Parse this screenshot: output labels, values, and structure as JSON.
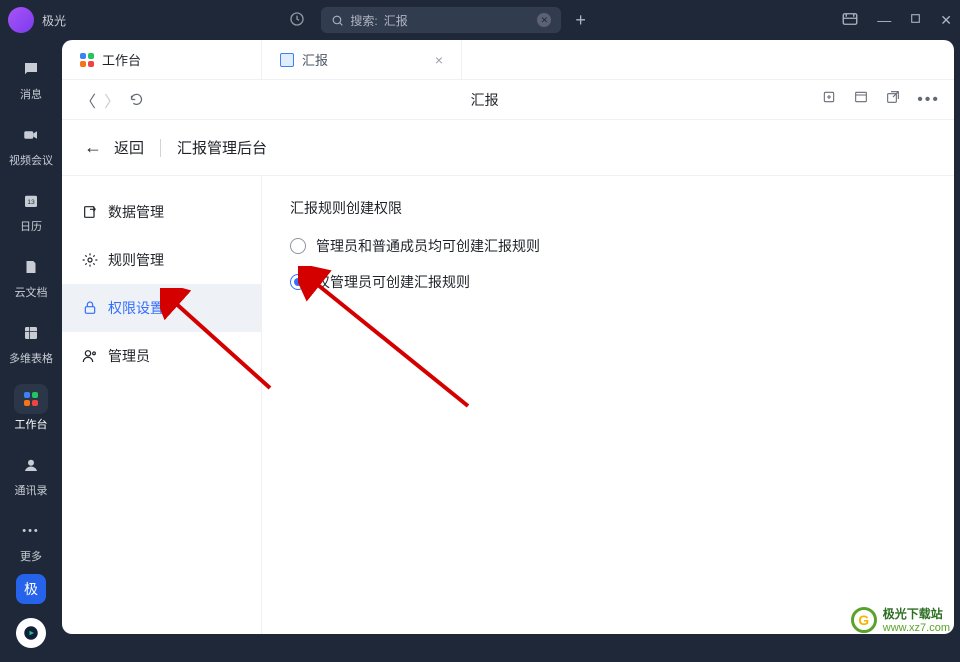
{
  "titlebar": {
    "brand": "极光",
    "search_prefix": "搜索:",
    "search_term": "汇报"
  },
  "leftrail": {
    "items": [
      {
        "label": "消息"
      },
      {
        "label": "视频会议"
      },
      {
        "label": "日历"
      },
      {
        "label": "云文档"
      },
      {
        "label": "多维表格"
      },
      {
        "label": "工作台"
      },
      {
        "label": "通讯录"
      },
      {
        "label": "更多"
      }
    ],
    "bottom_badge": "极"
  },
  "tabs": {
    "workbench": "工作台",
    "report": "汇报"
  },
  "toolbar": {
    "title": "汇报"
  },
  "page_header": {
    "back": "返回",
    "title": "汇报管理后台"
  },
  "side_menu": {
    "items": [
      {
        "label": "数据管理"
      },
      {
        "label": "规则管理"
      },
      {
        "label": "权限设置"
      },
      {
        "label": "管理员"
      }
    ]
  },
  "panel": {
    "title": "汇报规则创建权限",
    "options": [
      {
        "label": "管理员和普通成员均可创建汇报规则",
        "checked": false
      },
      {
        "label": "仅管理员可创建汇报规则",
        "checked": true
      }
    ]
  },
  "watermark": {
    "text": "极光下载站",
    "url": "www.xz7.com"
  }
}
